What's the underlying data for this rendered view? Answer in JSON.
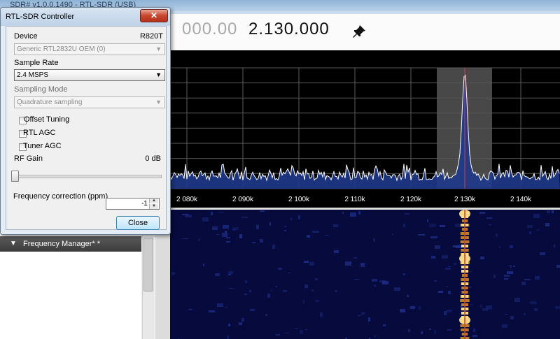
{
  "window": {
    "title": "SDR# v1.0.0.1490 - RTL-SDR (USB)"
  },
  "frequency": {
    "dim_part": "000.00",
    "bright_part": "2.130.000",
    "pin_icon": "pin-icon"
  },
  "frequency_manager": {
    "arrow": "▼",
    "label": "Frequency Manager* *"
  },
  "spectrum": {
    "axis_labels": [
      "2 080k",
      "2 090k",
      "2 100k",
      "2 110k",
      "2 120k",
      "2 130k",
      "2 140k"
    ],
    "colors": {
      "background": "#000000",
      "grid": "#5a5a5a",
      "trace": "#ffffff",
      "fill": "#1f3a8c",
      "highlight": "#555555",
      "center_line": "#ff2a2a"
    }
  },
  "waterfall": {
    "colors": {
      "background": "#060a3c",
      "noise": "#1f2f8a",
      "signal_hot": "#ffe08a",
      "center_line": "#ff2a2a"
    }
  },
  "dialog": {
    "title": "RTL-SDR Controller",
    "close_glyph": "✕",
    "device_label": "Device",
    "device_tuner": "R820T",
    "device_value": "Generic RTL2832U OEM (0)",
    "sample_rate_label": "Sample Rate",
    "sample_rate_value": "2.4 MSPS",
    "sampling_mode_label": "Sampling Mode",
    "sampling_mode_value": "Quadrature sampling",
    "offset_tuning_label": "Offset Tuning",
    "offset_tuning_checked": false,
    "rtl_agc_label": "RTL AGC",
    "rtl_agc_checked": false,
    "tuner_agc_label": "Tuner AGC",
    "tuner_agc_checked": false,
    "rf_gain_label": "RF Gain",
    "rf_gain_value": "0 dB",
    "rf_gain_level": 0,
    "freq_correction_label": "Frequency correction (ppm)",
    "freq_correction_value": "-1",
    "close_button": "Close"
  }
}
